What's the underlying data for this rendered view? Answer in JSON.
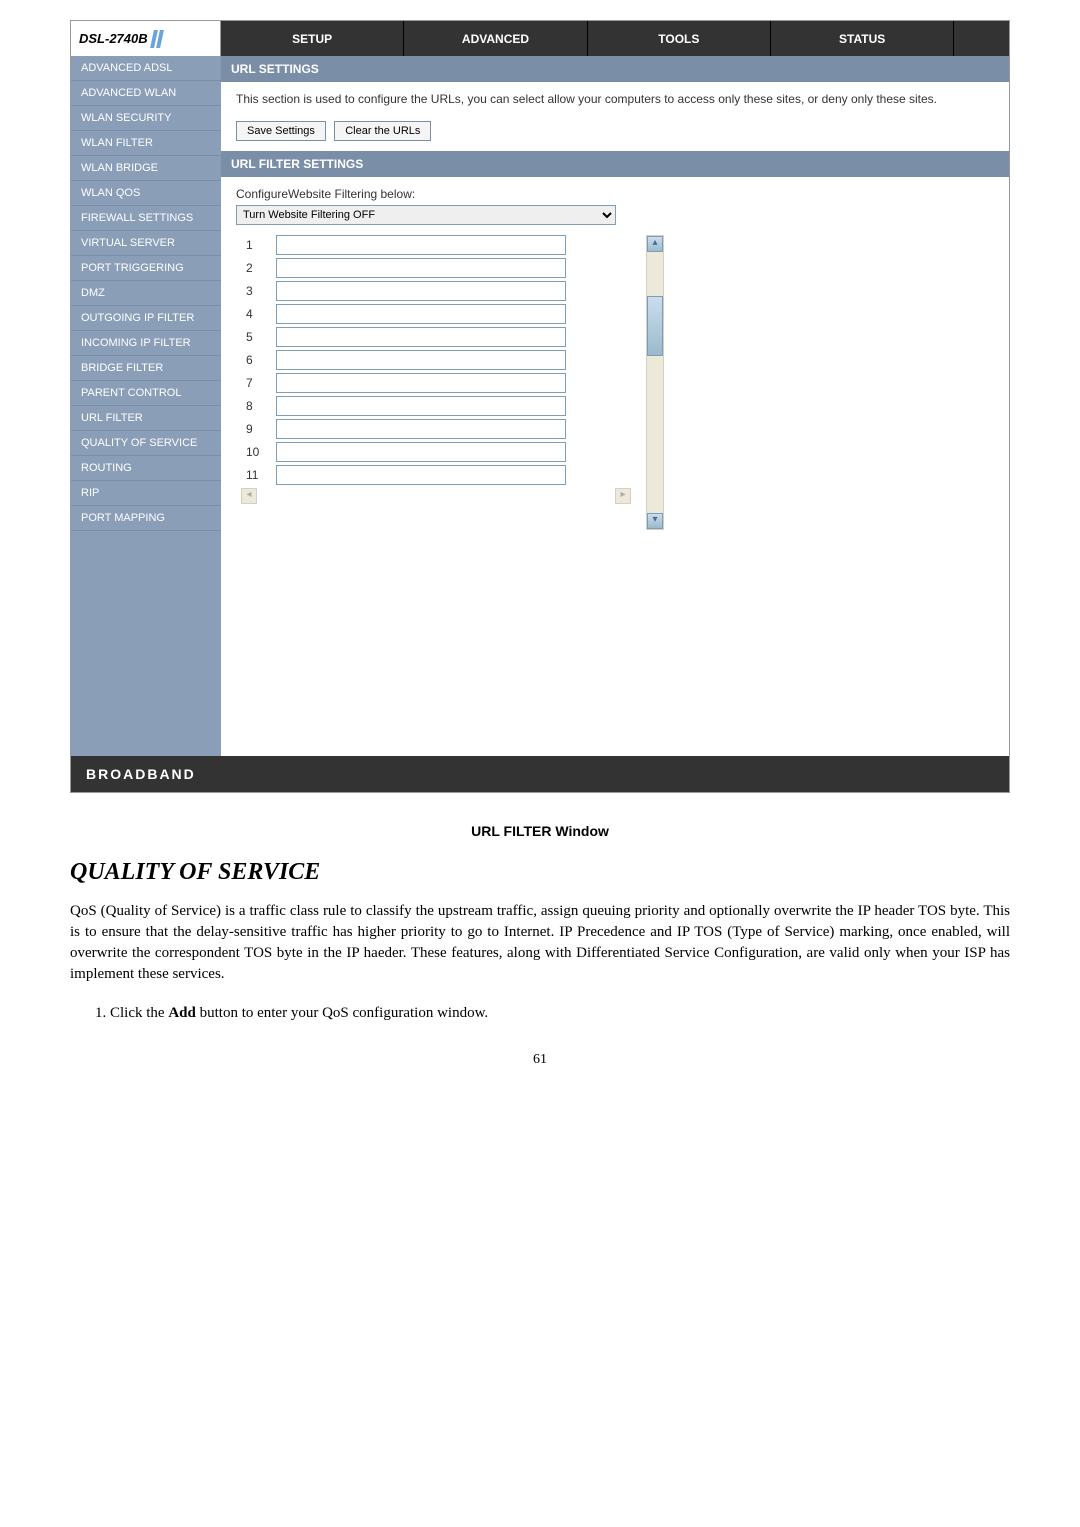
{
  "logo": "DSL-2740B",
  "nav": {
    "setup": "SETUP",
    "advanced": "ADVANCED",
    "tools": "TOOLS",
    "status": "STATUS"
  },
  "sidebar": [
    "ADVANCED ADSL",
    "ADVANCED WLAN",
    "WLAN SECURITY",
    "WLAN FILTER",
    "WLAN BRIDGE",
    "WLAN QOS",
    "FIREWALL SETTINGS",
    "VIRTUAL SERVER",
    "PORT TRIGGERING",
    "DMZ",
    "OUTGOING IP FILTER",
    "INCOMING IP FILTER",
    "BRIDGE FILTER",
    "PARENT CONTROL",
    "URL FILTER",
    "QUALITY OF SERVICE",
    "ROUTING",
    "RIP",
    "PORT MAPPING"
  ],
  "url_settings": {
    "header": "URL SETTINGS",
    "desc": "This section is used to configure the URLs, you can select allow your computers to access only these sites, or deny only these sites.",
    "save_btn": "Save Settings",
    "clear_btn": "Clear the URLs"
  },
  "url_filter": {
    "header": "URL FILTER SETTINGS",
    "label": "ConfigureWebsite Filtering below:",
    "select_value": "Turn Website Filtering OFF",
    "rows": [
      "1",
      "2",
      "3",
      "4",
      "5",
      "6",
      "7",
      "8",
      "9",
      "10",
      "11"
    ]
  },
  "footer": "BROADBAND",
  "caption": "URL FILTER Window",
  "doc": {
    "heading": "QUALITY OF SERVICE",
    "para": "QoS (Quality of Service) is a traffic class rule to classify the upstream traffic, assign queuing priority and optionally overwrite the IP header TOS byte. This is to ensure that the delay-sensitive traffic has higher priority to go to Internet. IP Precedence and IP TOS (Type of Service) marking, once enabled, will overwrite the correspondent TOS byte in the IP haeder. These features, along with Differentiated Service Configuration, are valid only when your ISP has implement these services.",
    "list_prefix": "Click the ",
    "list_bold": "Add",
    "list_suffix": " button to enter your QoS configuration window.",
    "page": "61"
  }
}
